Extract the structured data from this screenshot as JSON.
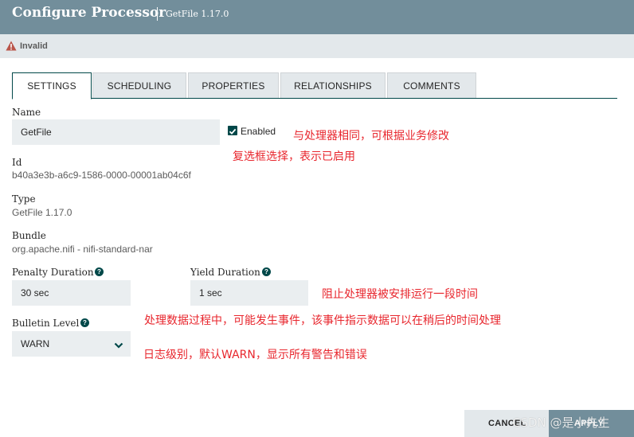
{
  "header": {
    "title": "Configure Processor",
    "subtitle": "GetFile 1.17.0"
  },
  "status": {
    "icon": "warning-triangle-icon",
    "text": "Invalid"
  },
  "tabs": [
    {
      "label": "SETTINGS",
      "active": true
    },
    {
      "label": "SCHEDULING",
      "active": false
    },
    {
      "label": "PROPERTIES",
      "active": false
    },
    {
      "label": "RELATIONSHIPS",
      "active": false
    },
    {
      "label": "COMMENTS",
      "active": false
    }
  ],
  "settings": {
    "name_label": "Name",
    "name_value": "GetFile",
    "enabled_label": "Enabled",
    "enabled_checked": true,
    "id_label": "Id",
    "id_value": "b40a3e3b-a6c9-1586-0000-00001ab04c6f",
    "type_label": "Type",
    "type_value": "GetFile 1.17.0",
    "bundle_label": "Bundle",
    "bundle_value": "org.apache.nifi - nifi-standard-nar",
    "penalty_label": "Penalty Duration",
    "penalty_value": "30 sec",
    "yield_label": "Yield Duration",
    "yield_value": "1 sec",
    "bulletin_label": "Bulletin Level",
    "bulletin_value": "WARN"
  },
  "annotations": {
    "name_note": "与处理器相同，可根据业务修改",
    "enabled_note": "复选框选择，表示已启用",
    "yield_note": "阻止处理器被安排运行一段时间",
    "penalty_note": "处理数据过程中，可能发生事件，该事件指示数据可以在稍后的时间处理",
    "bulletin_note": "日志级别，默认WARN，显示所有警告和错误"
  },
  "footer": {
    "cancel_label": "CANCEL",
    "apply_label": "APPLY"
  },
  "watermark": "CSDN @是小先生",
  "colors": {
    "header": "#728e9b",
    "accent": "#004849",
    "note": "#e8262d",
    "warning": "#ba554a"
  }
}
